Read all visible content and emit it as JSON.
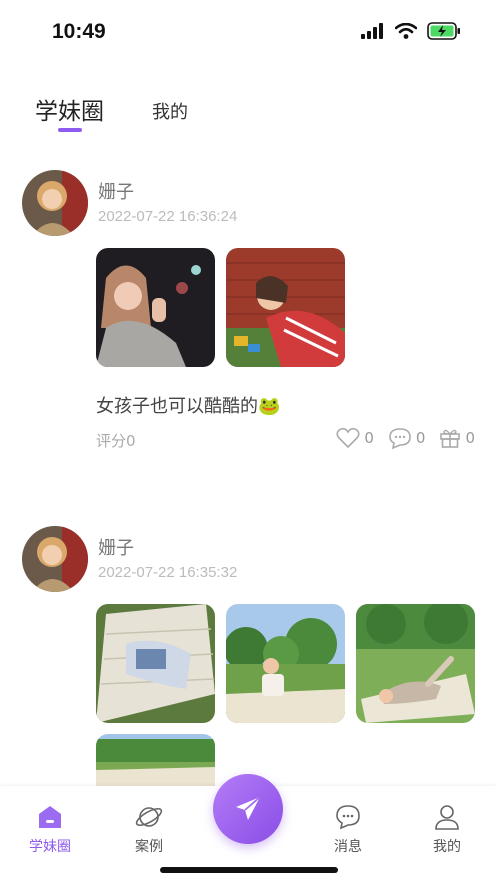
{
  "status": {
    "time": "10:49"
  },
  "tabs": {
    "active": "学妹圈",
    "other": "我的"
  },
  "posts": [
    {
      "user": "姗子",
      "time": "2022-07-22 16:36:24",
      "text": "女孩子也可以酷酷的🐸",
      "score": "评分0",
      "likes": "0",
      "comments": "0",
      "gifts": "0"
    },
    {
      "user": "姗子",
      "time": "2022-07-22 16:35:32"
    }
  ],
  "nav": {
    "items": [
      "学妹圈",
      "案例",
      "消息",
      "我的"
    ]
  },
  "colors": {
    "accent": "#8e5bf0"
  }
}
